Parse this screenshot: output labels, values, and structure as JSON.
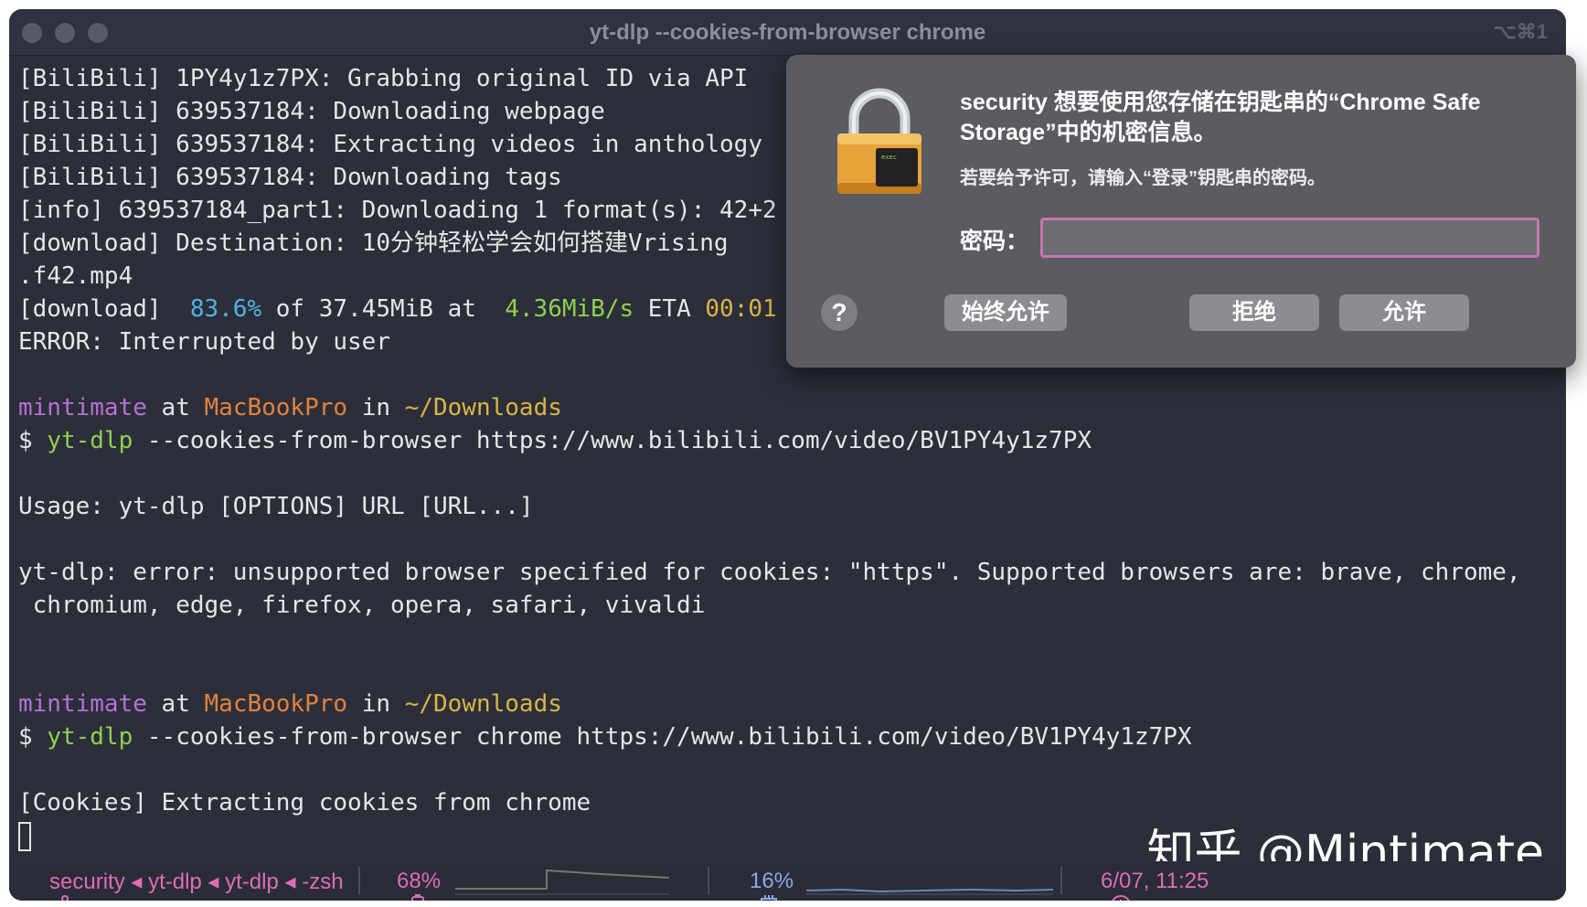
{
  "window": {
    "title": "yt-dlp --cookies-from-browser chrome",
    "shortcut": "⌥⌘1"
  },
  "terminal": {
    "lines": [
      "[BiliBili] 1PY4y1z7PX: Grabbing original ID via API",
      "[BiliBili] 639537184: Downloading webpage",
      "[BiliBili] 639537184: Extracting videos in anthology",
      "[BiliBili] 639537184: Downloading tags",
      "[info] 639537184_part1: Downloading 1 format(s): 42+2",
      "[download] Destination: 10分钟轻松学会如何搭建Vrising",
      ".f42.mp4"
    ],
    "progress": {
      "prefix": "[download]  ",
      "percent": "83.6%",
      "of": " of 37.45MiB at  ",
      "speed": "4.36MiB/s",
      "eta_label": " ETA ",
      "eta": "00:01"
    },
    "error_line": "ERROR: Interrupted by user",
    "prompt1": {
      "user": "mintimate",
      "at": " at ",
      "host": "MacBookPro",
      "in": " in ",
      "dir": "~/Downloads",
      "dollar": "$ ",
      "cmd": "yt-dlp",
      "args": " --cookies-from-browser https://www.bilibili.com/video/BV1PY4y1z7PX"
    },
    "usage": "Usage: yt-dlp [OPTIONS] URL [URL...]",
    "error1": "yt-dlp: error: unsupported browser specified for cookies: \"https\". Supported browsers are: brave, chrome,",
    "error2": " chromium, edge, firefox, opera, safari, vivaldi",
    "prompt2": {
      "user": "mintimate",
      "at": " at ",
      "host": "MacBookPro",
      "in": " in ",
      "dir": "~/Downloads",
      "dollar": "$ ",
      "cmd": "yt-dlp",
      "args": " --cookies-from-browser chrome https://www.bilibili.com/video/BV1PY4y1z7PX"
    },
    "cookies_line": "[Cookies] Extracting cookies from chrome"
  },
  "watermark": "知乎 @Mintimate",
  "statusbar": {
    "branch_icon": "branch-icon",
    "processes": "security ◂ yt-dlp ◂ yt-dlp ◂ -zsh",
    "battery": "68%",
    "cpu": "16%",
    "clock": "6/07, 11:25"
  },
  "dialog": {
    "icon": "lock-icon",
    "exec_label": "exec",
    "title": "security 想要使用您存储在钥匙串的“Chrome Safe Storage”中的机密信息。",
    "subtitle": "若要给予许可，请输入“登录”钥匙串的密码。",
    "password_label": "密码：",
    "password_value": "",
    "help": "?",
    "always_allow": "始终允许",
    "deny": "拒绝",
    "allow": "允许"
  },
  "colors": {
    "terminal_bg": "#2c2f3a",
    "user": "#b76fd7",
    "host": "#e3823d",
    "dir": "#d9b545",
    "cmd": "#8fd051",
    "percent": "#4db3e6",
    "status_text": "#e06bb8",
    "dialog_bg": "#5a5c61",
    "input_border": "#c874b0"
  }
}
